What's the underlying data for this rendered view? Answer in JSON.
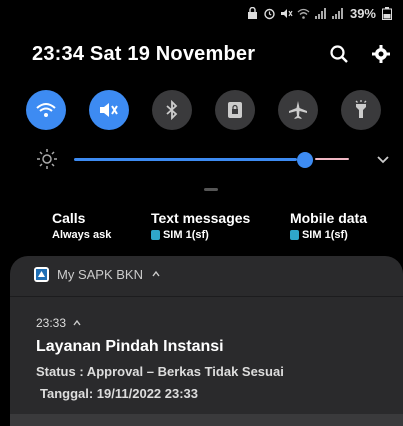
{
  "status_bar": {
    "battery": "39%"
  },
  "header": {
    "datetime": "23:34  Sat 19 November"
  },
  "quick_toggles": [
    {
      "icon": "wifi-icon",
      "on": true
    },
    {
      "icon": "mute-icon",
      "on": true
    },
    {
      "icon": "bluetooth-icon",
      "on": false
    },
    {
      "icon": "lock-rotation-icon",
      "on": false
    },
    {
      "icon": "airplane-icon",
      "on": false
    },
    {
      "icon": "flashlight-icon",
      "on": false
    }
  ],
  "brightness": {
    "level": 0.84
  },
  "sim": {
    "calls": {
      "title": "Calls",
      "sub": "Always ask"
    },
    "text": {
      "title": "Text messages",
      "sub": "SIM 1(sf)"
    },
    "data": {
      "title": "Mobile data",
      "sub": "SIM 1(sf)"
    }
  },
  "notification": {
    "app_name": "My SAPK BKN",
    "time": "23:33",
    "title": "Layanan Pindah Instansi",
    "line1": "Status : Approval – Berkas Tidak Sesuai",
    "line2": "Tanggal: 19/11/2022 23:33"
  }
}
